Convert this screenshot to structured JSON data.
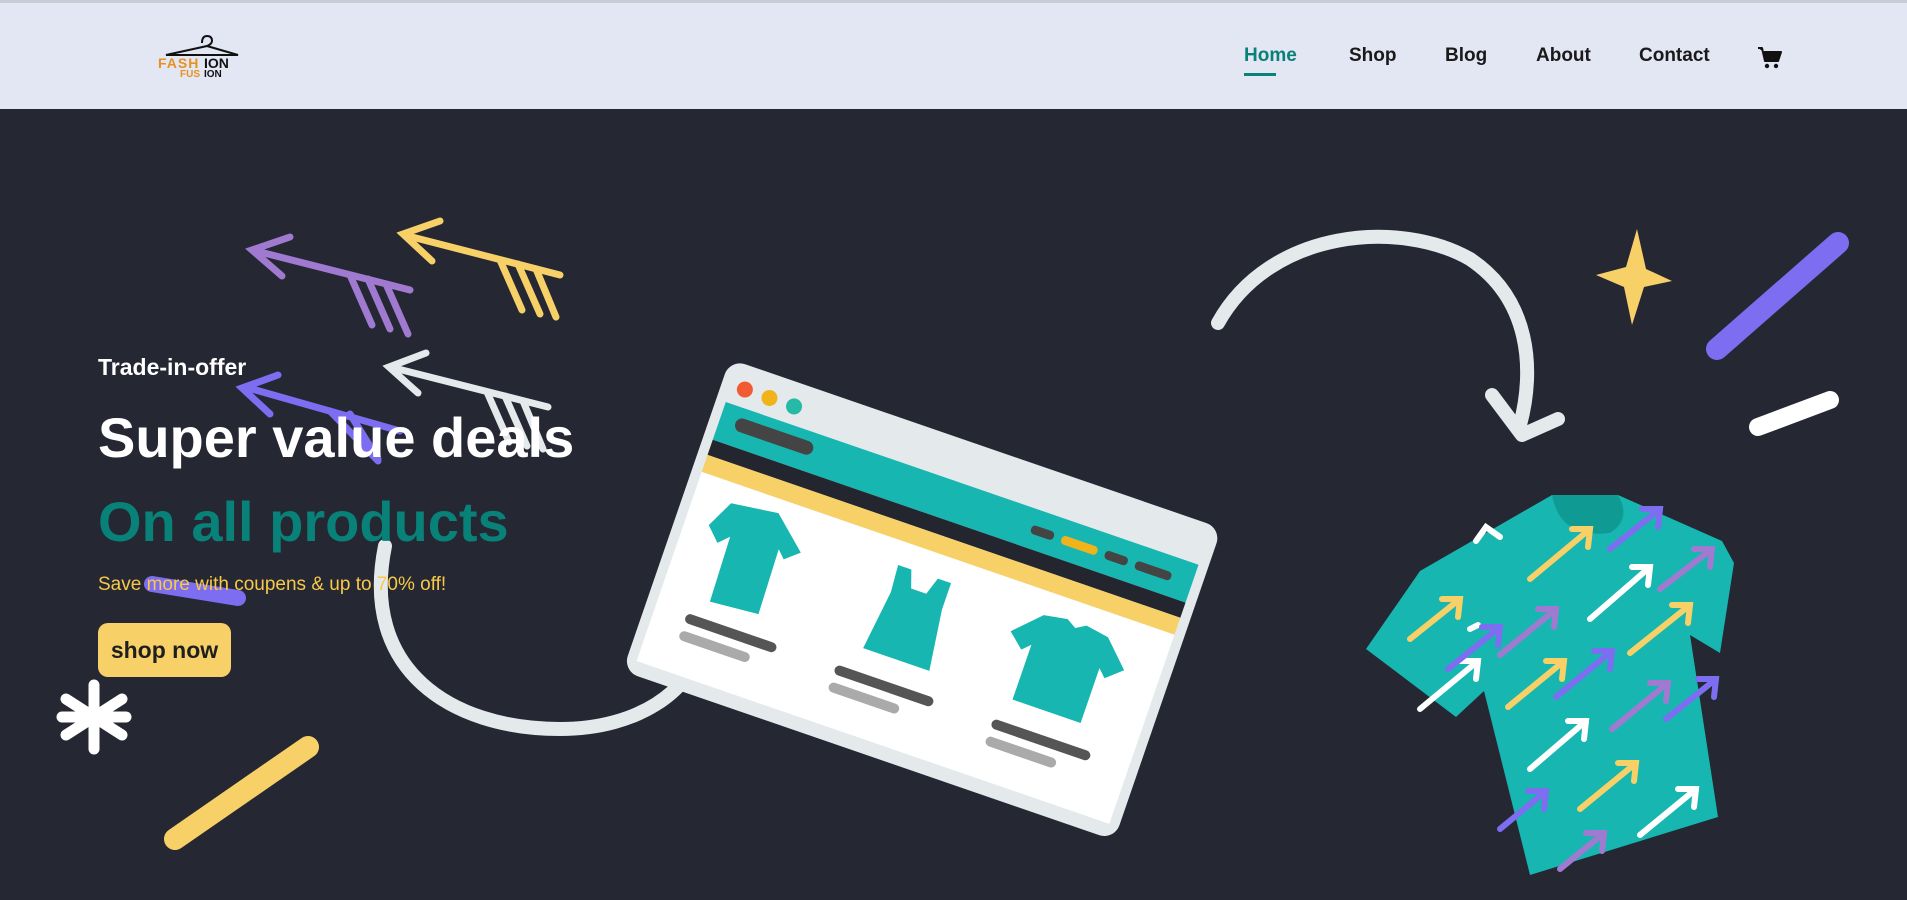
{
  "brand": {
    "logo_line1": "FASHION",
    "logo_line2": "FUSION",
    "accent": "#088178",
    "logo_orange": "#e8911e"
  },
  "nav": {
    "items": [
      {
        "label": "Home",
        "active": true
      },
      {
        "label": "Shop",
        "active": false
      },
      {
        "label": "Blog",
        "active": false
      },
      {
        "label": "About",
        "active": false
      },
      {
        "label": "Contact",
        "active": false
      }
    ],
    "cart_icon": "shopping-cart-icon"
  },
  "hero": {
    "eyebrow": "Trade-in-offer",
    "title": "Super value deals",
    "subtitle": "On all products",
    "description": "Save more with coupens & up to 70% off!",
    "cta_label": "shop now",
    "background": "#252733"
  },
  "colors": {
    "teal": "#17b6b0",
    "yellow": "#f7d168",
    "purple": "#7d6df0",
    "lilac": "#a07ad0",
    "white": "#ffffff",
    "light": "#e4e9ec"
  }
}
